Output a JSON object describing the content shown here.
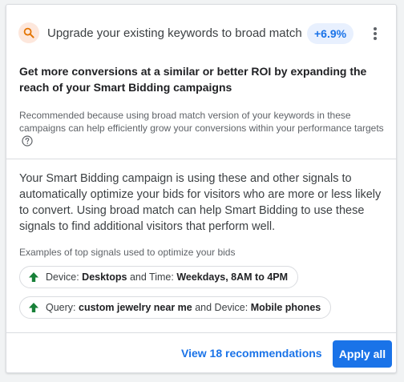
{
  "header": {
    "title": "Upgrade your existing keywords to broad match",
    "lift": "+6.9%",
    "icon": "search-icon",
    "menu_icon": "more-vert-icon"
  },
  "headline": "Get more conversions at a similar or better ROI by expanding the reach of your Smart Bidding campaigns",
  "reason": "Recommended because using broad match version of your keywords in these campaigns can help efficiently grow your conversions within your performance targets",
  "body": "Your Smart Bidding campaign is using these and other signals to automatically optimize your bids for visitors who are more or less likely to convert. Using broad match can help Smart Bidding to use these signals to find additional visitors that perform well.",
  "examples_label": "Examples of top signals used to optimize your bids",
  "signals": [
    {
      "k1": "Device:",
      "v1": "Desktops",
      "mid": "and Time:",
      "v2": "Weekdays, 8AM to 4PM"
    },
    {
      "k1": "Query:",
      "v1": "custom jewelry near me",
      "mid": "and Device:",
      "v2": "Mobile phones"
    }
  ],
  "footer": {
    "view_label": "View 18 recommendations",
    "apply_label": "Apply all"
  },
  "colors": {
    "accent": "#1a73e8",
    "arrow_green": "#188038",
    "search_badge_bg": "#fde7dc",
    "search_icon": "#e37400"
  }
}
